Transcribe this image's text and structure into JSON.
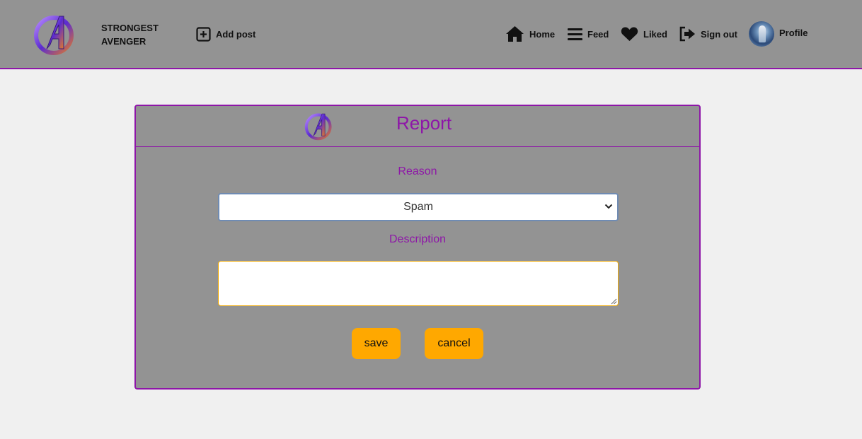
{
  "brand": {
    "line1": "STRONGEST",
    "line2": "AVENGER",
    "logo_icon": "avengers-logo-icon"
  },
  "nav": {
    "add_post": "Add post",
    "home": "Home",
    "feed": "Feed",
    "liked": "Liked",
    "sign_out": "Sign out",
    "profile": "Profile"
  },
  "report": {
    "title": "Report",
    "reason_label": "Reason",
    "reason_value": "Spam",
    "description_label": "Description",
    "description_value": "",
    "save_label": "save",
    "cancel_label": "cancel"
  },
  "colors": {
    "accent": "#8e16a8",
    "button": "#ffa800",
    "panel": "#939393",
    "page_bg": "#f0f0f0"
  }
}
